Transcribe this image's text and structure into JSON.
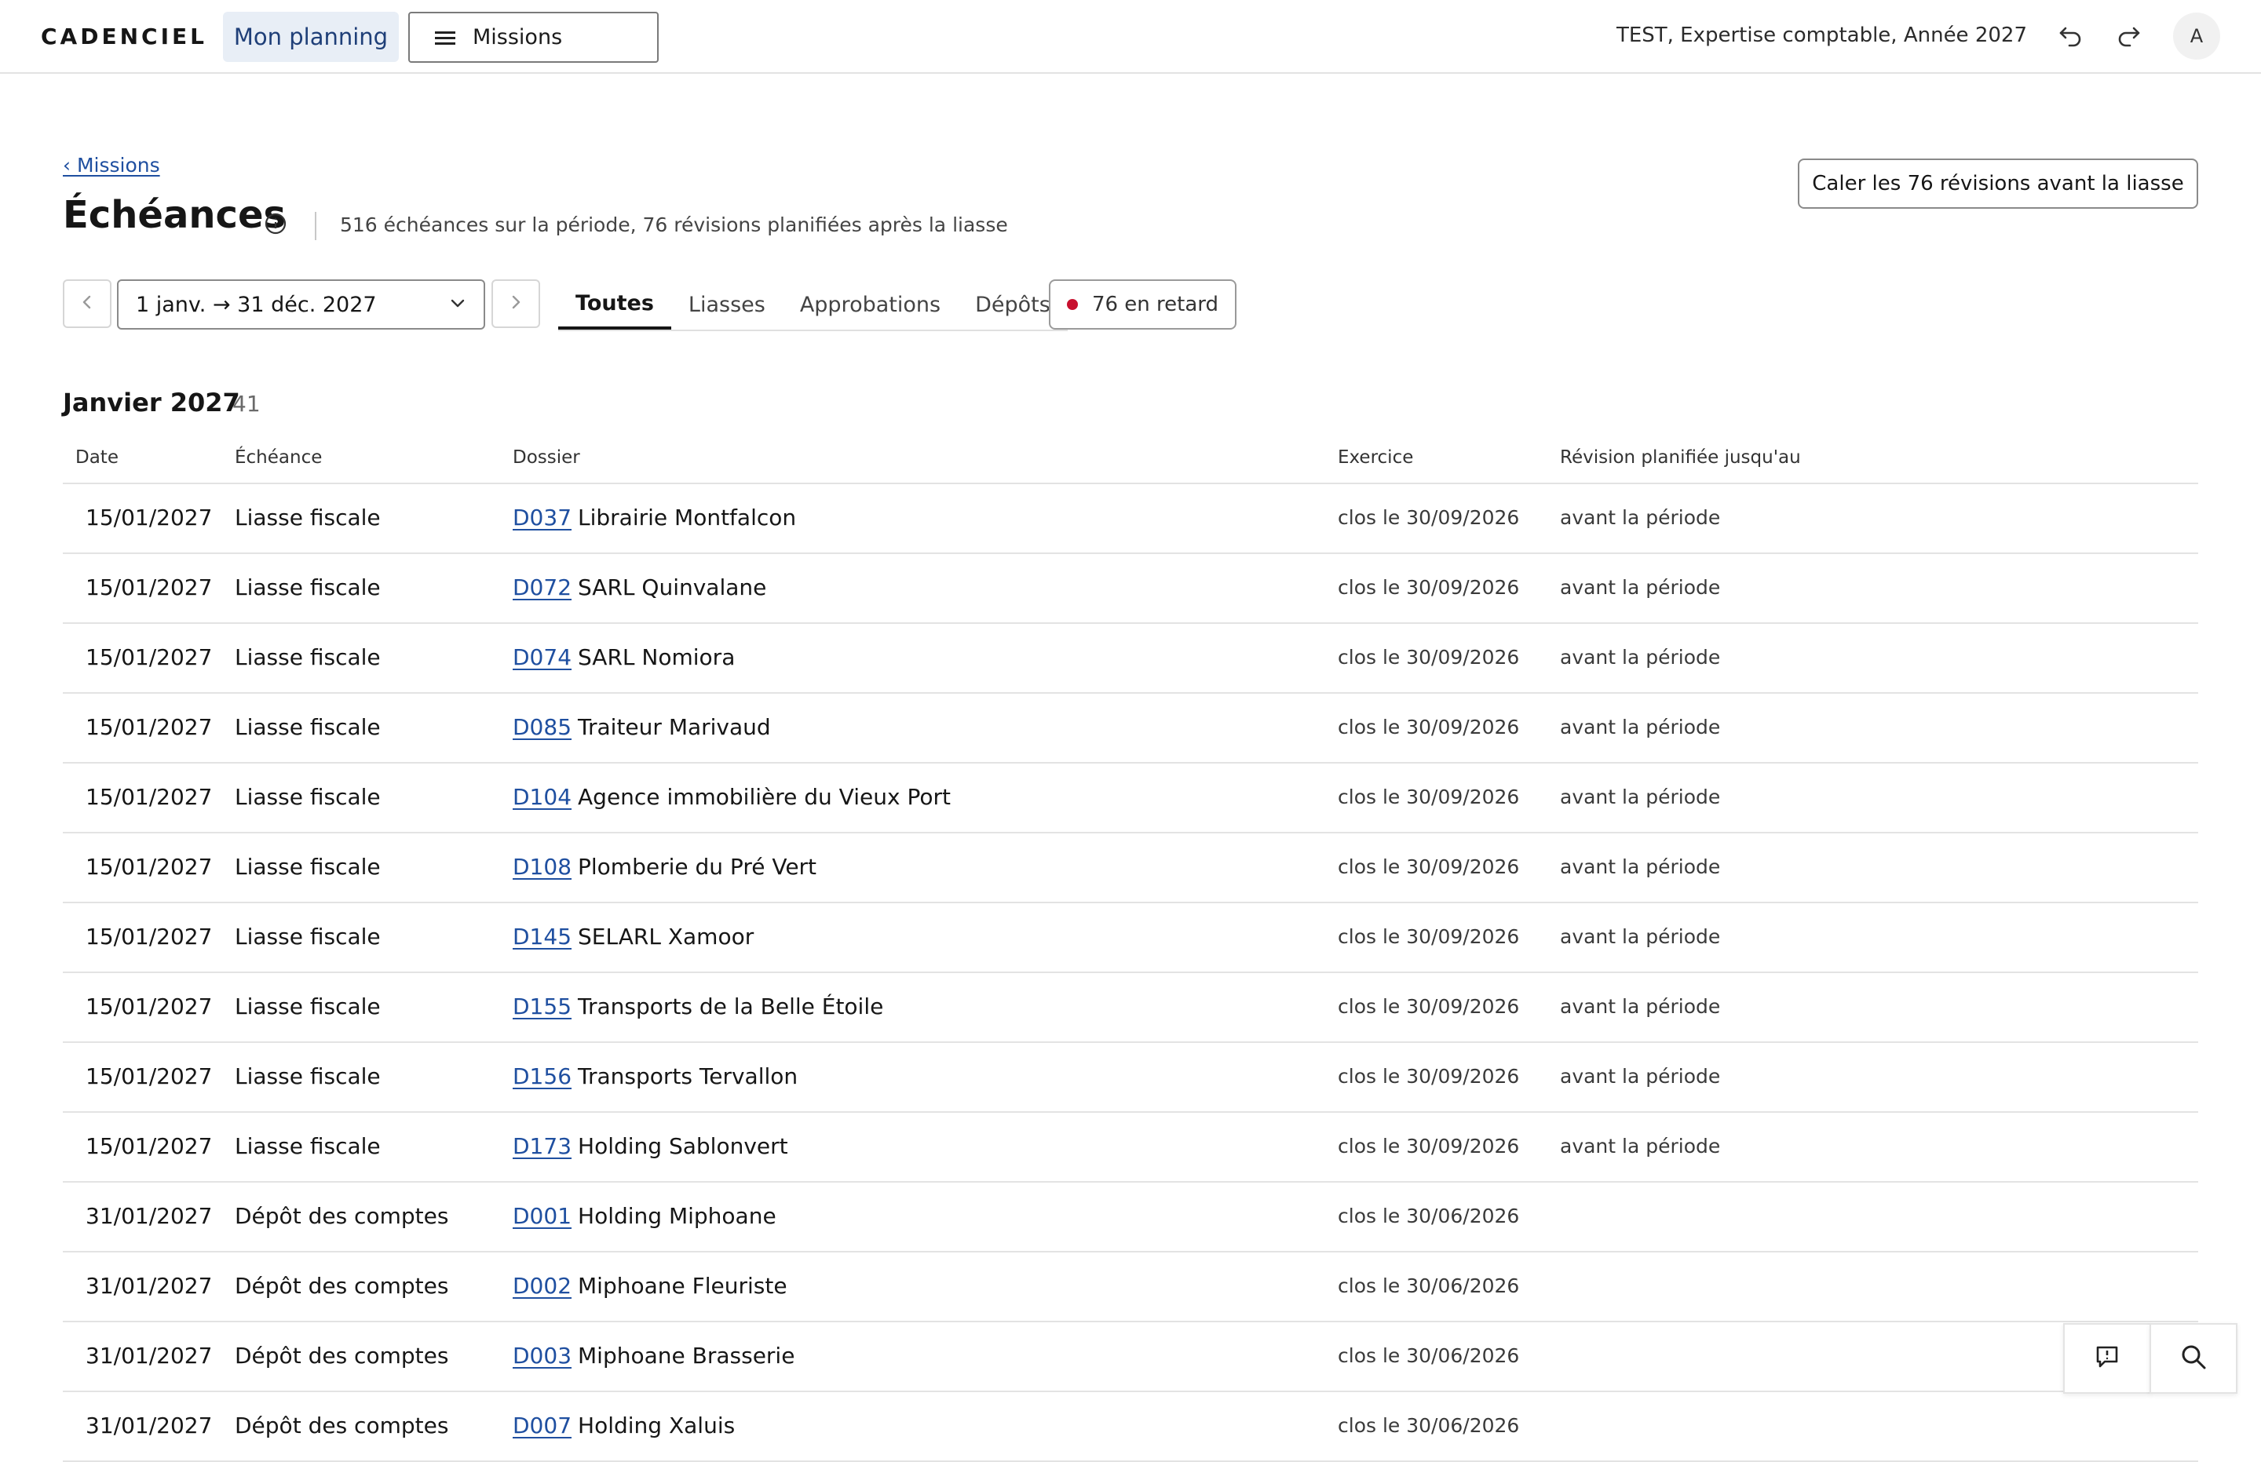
{
  "topbar": {
    "logo": "CADENCIEL",
    "planning_label": "Mon planning",
    "missions_label": "Missions",
    "context": "TEST, Expertise comptable, Année 2027",
    "avatar_initial": "A"
  },
  "header": {
    "breadcrumb": "‹ Missions",
    "title": "Échéances",
    "subtitle": "516 échéances sur la période, 76 révisions planifiées après la liasse",
    "cta_label": "Caler les 76 révisions avant la liasse"
  },
  "filters": {
    "period": "1 janv. → 31 déc. 2027",
    "tabs": [
      {
        "label": "Toutes",
        "active": true
      },
      {
        "label": "Liasses",
        "active": false
      },
      {
        "label": "Approbations",
        "active": false
      },
      {
        "label": "Dépôts",
        "active": false
      }
    ],
    "late_label": "76 en retard",
    "late_color": "#c8102e"
  },
  "section": {
    "title": "Janvier 2027",
    "count": "41",
    "columns": {
      "date": "Date",
      "echeance": "Échéance",
      "dossier": "Dossier",
      "exercice": "Exercice",
      "revision": "Révision planifiée jusqu'au"
    },
    "rows": [
      {
        "date": "15/01/2027",
        "echeance": "Liasse fiscale",
        "code": "D037",
        "name": "Librairie Montfalcon",
        "exercice": "clos le 30/09/2026",
        "revision": "avant la période"
      },
      {
        "date": "15/01/2027",
        "echeance": "Liasse fiscale",
        "code": "D072",
        "name": "SARL Quinvalane",
        "exercice": "clos le 30/09/2026",
        "revision": "avant la période"
      },
      {
        "date": "15/01/2027",
        "echeance": "Liasse fiscale",
        "code": "D074",
        "name": "SARL Nomiora",
        "exercice": "clos le 30/09/2026",
        "revision": "avant la période"
      },
      {
        "date": "15/01/2027",
        "echeance": "Liasse fiscale",
        "code": "D085",
        "name": "Traiteur Marivaud",
        "exercice": "clos le 30/09/2026",
        "revision": "avant la période"
      },
      {
        "date": "15/01/2027",
        "echeance": "Liasse fiscale",
        "code": "D104",
        "name": "Agence immobilière du Vieux Port",
        "exercice": "clos le 30/09/2026",
        "revision": "avant la période"
      },
      {
        "date": "15/01/2027",
        "echeance": "Liasse fiscale",
        "code": "D108",
        "name": "Plomberie du Pré Vert",
        "exercice": "clos le 30/09/2026",
        "revision": "avant la période"
      },
      {
        "date": "15/01/2027",
        "echeance": "Liasse fiscale",
        "code": "D145",
        "name": "SELARL Xamoor",
        "exercice": "clos le 30/09/2026",
        "revision": "avant la période"
      },
      {
        "date": "15/01/2027",
        "echeance": "Liasse fiscale",
        "code": "D155",
        "name": "Transports de la Belle Étoile",
        "exercice": "clos le 30/09/2026",
        "revision": "avant la période"
      },
      {
        "date": "15/01/2027",
        "echeance": "Liasse fiscale",
        "code": "D156",
        "name": "Transports Tervallon",
        "exercice": "clos le 30/09/2026",
        "revision": "avant la période"
      },
      {
        "date": "15/01/2027",
        "echeance": "Liasse fiscale",
        "code": "D173",
        "name": "Holding Sablonvert",
        "exercice": "clos le 30/09/2026",
        "revision": "avant la période"
      },
      {
        "date": "31/01/2027",
        "echeance": "Dépôt des comptes",
        "code": "D001",
        "name": "Holding Miphoane",
        "exercice": "clos le 30/06/2026",
        "revision": ""
      },
      {
        "date": "31/01/2027",
        "echeance": "Dépôt des comptes",
        "code": "D002",
        "name": "Miphoane Fleuriste",
        "exercice": "clos le 30/06/2026",
        "revision": ""
      },
      {
        "date": "31/01/2027",
        "echeance": "Dépôt des comptes",
        "code": "D003",
        "name": "Miphoane Brasserie",
        "exercice": "clos le 30/06/2026",
        "revision": ""
      },
      {
        "date": "31/01/2027",
        "echeance": "Dépôt des comptes",
        "code": "D007",
        "name": "Holding Xaluis",
        "exercice": "clos le 30/06/2026",
        "revision": ""
      }
    ]
  },
  "floating": {
    "feedback_icon": "feedback-icon",
    "search_icon": "search-icon"
  }
}
